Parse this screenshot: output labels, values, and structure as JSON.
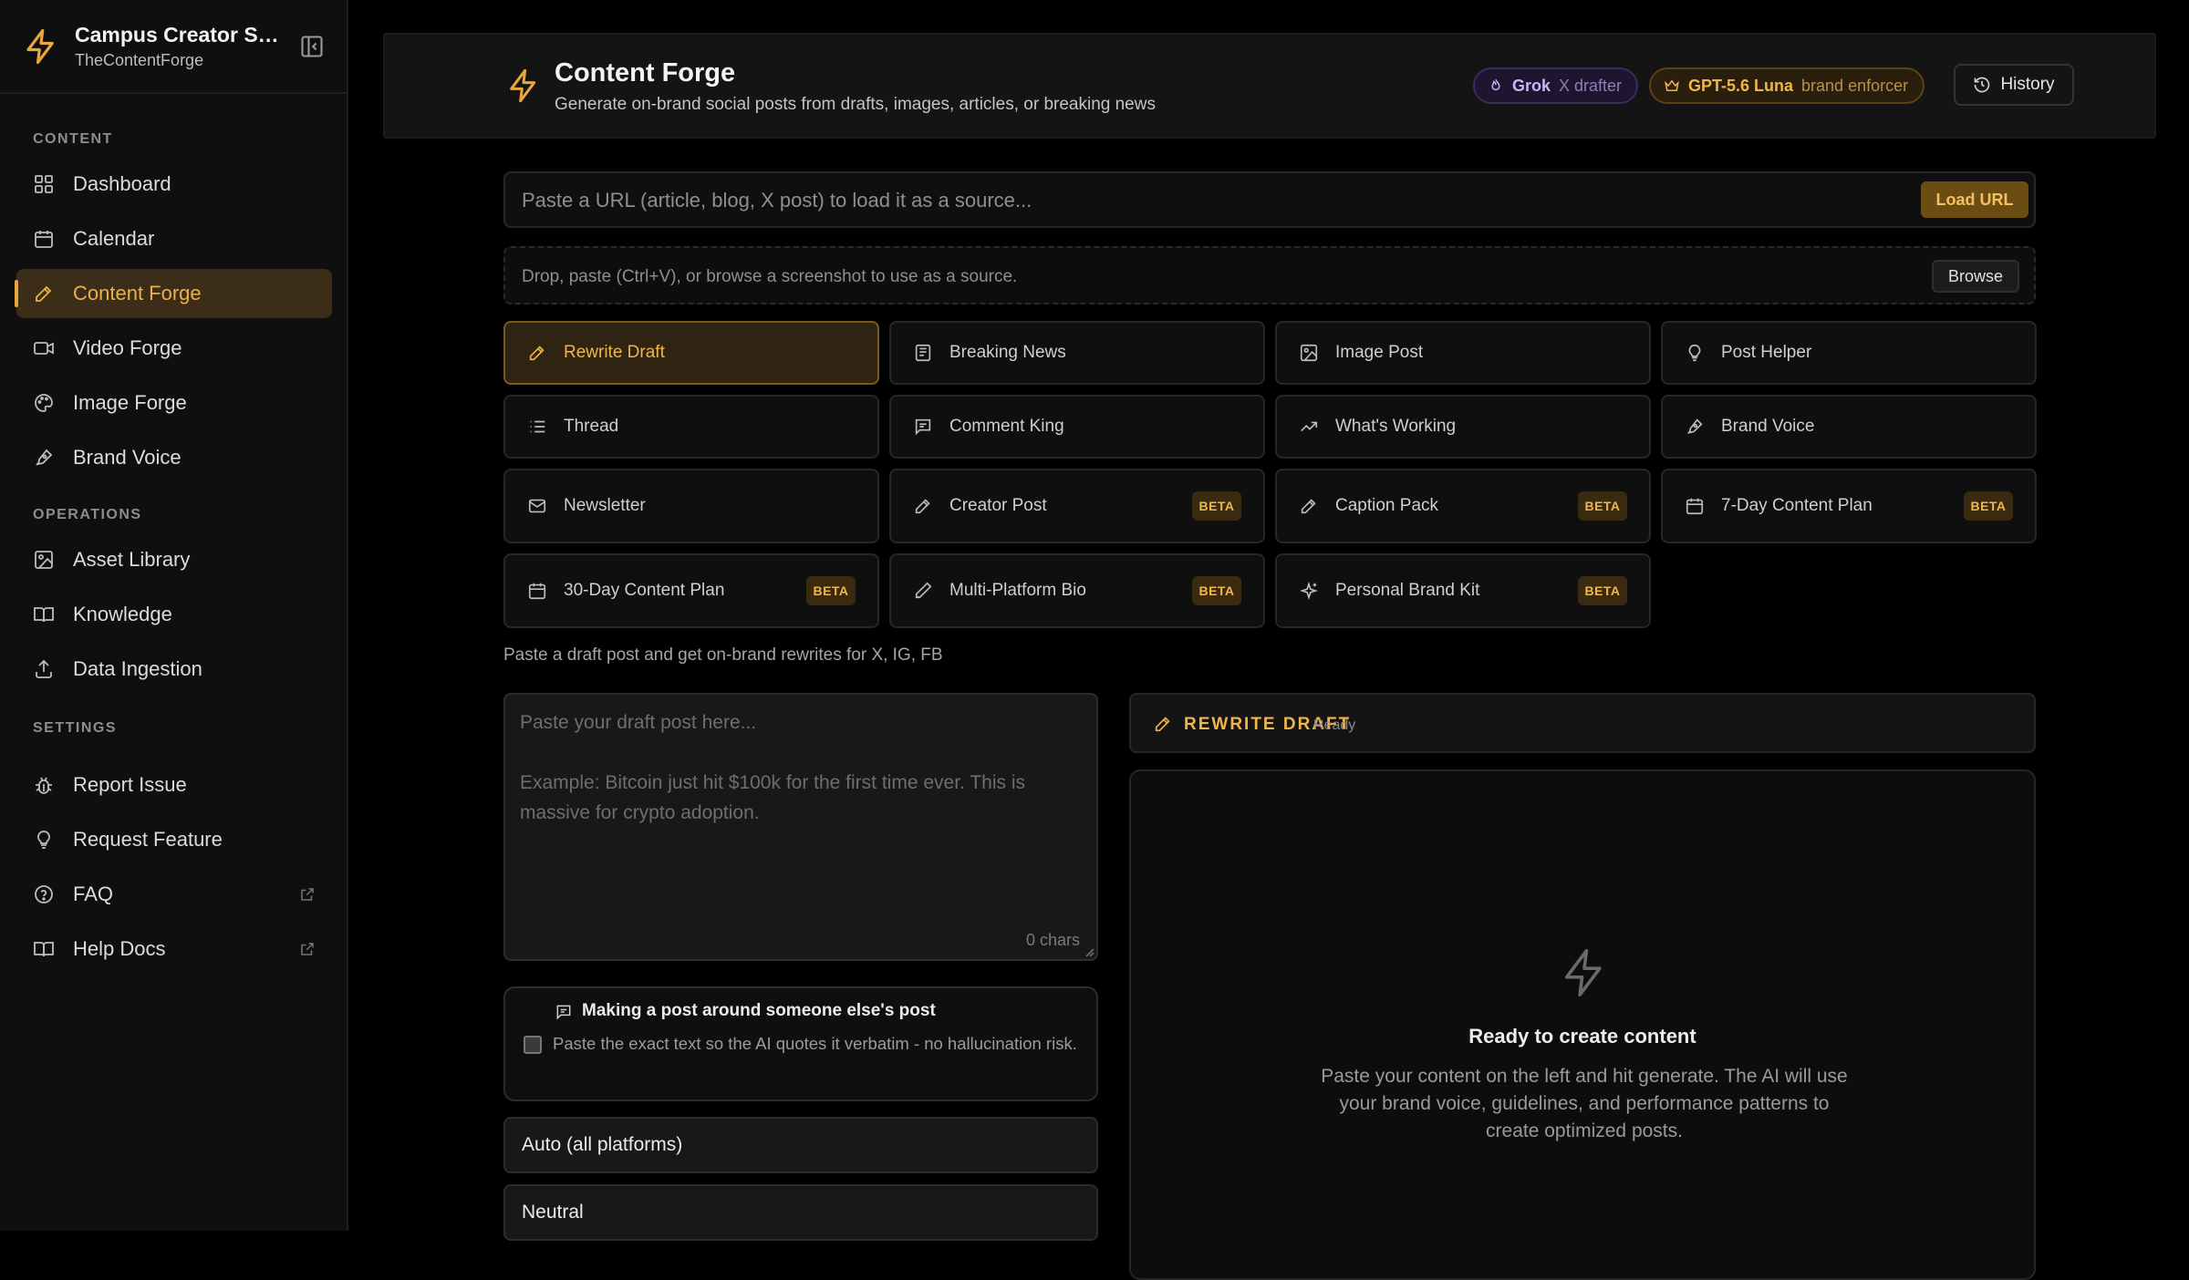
{
  "sidebar": {
    "app_title": "Campus Creator Stu...",
    "workspace": "TheContentForge",
    "sections": {
      "content": "CONTENT",
      "operations": "OPERATIONS",
      "settings": "SETTINGS"
    },
    "content_items": [
      {
        "label": "Dashboard",
        "icon": "dashboard-icon"
      },
      {
        "label": "Calendar",
        "icon": "calendar-icon"
      },
      {
        "label": "Content Forge",
        "icon": "pencil-icon",
        "active": true
      },
      {
        "label": "Video Forge",
        "icon": "video-icon"
      },
      {
        "label": "Image Forge",
        "icon": "palette-icon"
      },
      {
        "label": "Brand Voice",
        "icon": "pen-nib-icon"
      }
    ],
    "operations_items": [
      {
        "label": "Asset Library",
        "icon": "image-icon"
      },
      {
        "label": "Knowledge",
        "icon": "book-icon"
      },
      {
        "label": "Data Ingestion",
        "icon": "upload-icon"
      }
    ],
    "settings_items": [
      {
        "label": "Report Issue",
        "icon": "bug-icon"
      },
      {
        "label": "Request Feature",
        "icon": "lightbulb-icon"
      },
      {
        "label": "FAQ",
        "icon": "help-circle-icon",
        "external": true
      },
      {
        "label": "Help Docs",
        "icon": "book-icon",
        "external": true
      }
    ]
  },
  "header": {
    "title": "Content Forge",
    "subtitle": "Generate on-brand social posts from drafts, images, articles, or breaking news",
    "grok_name": "Grok",
    "grok_role": "X drafter",
    "gpt_name": "GPT-5.6 Luna",
    "gpt_role": "brand enforcer",
    "history_label": "History"
  },
  "source": {
    "url_placeholder": "Paste a URL (article, blog, X post) to load it as a source...",
    "url_value": "",
    "load_label": "Load URL",
    "drop_text": "Drop, paste (Ctrl+V), or browse a screenshot to use as a source.",
    "browse_label": "Browse"
  },
  "tools": [
    {
      "label": "Rewrite Draft",
      "icon": "pencil-icon",
      "active": true,
      "beta": ""
    },
    {
      "label": "Breaking News",
      "icon": "newspaper-icon",
      "beta": ""
    },
    {
      "label": "Image Post",
      "icon": "image-icon",
      "beta": ""
    },
    {
      "label": "Post Helper",
      "icon": "lightbulb-icon",
      "beta": ""
    },
    {
      "label": "Thread",
      "icon": "list-icon",
      "beta": ""
    },
    {
      "label": "Comment King",
      "icon": "comment-icon",
      "beta": ""
    },
    {
      "label": "What's Working",
      "icon": "trending-up-icon",
      "beta": ""
    },
    {
      "label": "Brand Voice",
      "icon": "pen-nib-icon",
      "beta": ""
    },
    {
      "label": "Newsletter",
      "icon": "mail-icon",
      "beta": ""
    },
    {
      "label": "Creator Post",
      "icon": "pencil-icon",
      "beta": "BETA"
    },
    {
      "label": "Caption Pack",
      "icon": "pencil-icon",
      "beta": "BETA"
    },
    {
      "label": "7-Day Content Plan",
      "icon": "calendar-icon",
      "beta": "BETA"
    },
    {
      "label": "30-Day Content Plan",
      "icon": "calendar-icon",
      "beta": "BETA"
    },
    {
      "label": "Multi-Platform Bio",
      "icon": "pen-icon",
      "beta": "BETA"
    },
    {
      "label": "Personal Brand Kit",
      "icon": "sparkles-icon",
      "beta": "BETA"
    }
  ],
  "tool_hint": "Paste a draft post and get on-brand rewrites for X, IG, FB",
  "draft": {
    "placeholder": "Paste your draft post here...\n\nExample: Bitcoin just hit $100k for the first time ever. This is massive for crypto adoption.",
    "value": "",
    "char_count": "0 chars"
  },
  "quote_option": {
    "title": "Making a post around someone else's post",
    "description": "Paste the exact text so the AI quotes it verbatim - no hallucination risk.",
    "checked": false
  },
  "platform_select": "Auto (all platforms)",
  "tone_select": "Neutral",
  "output": {
    "mode_label": "REWRITE DRAFT",
    "status": "Ready",
    "empty_title": "Ready to create content",
    "empty_desc": "Paste your content on the left and hit generate. The AI will use your brand voice, guidelines, and performance patterns to create optimized posts."
  },
  "colors": {
    "accent": "#e7a73b",
    "active_bg": "#3b2d17",
    "grok": "#c9b3ff"
  }
}
